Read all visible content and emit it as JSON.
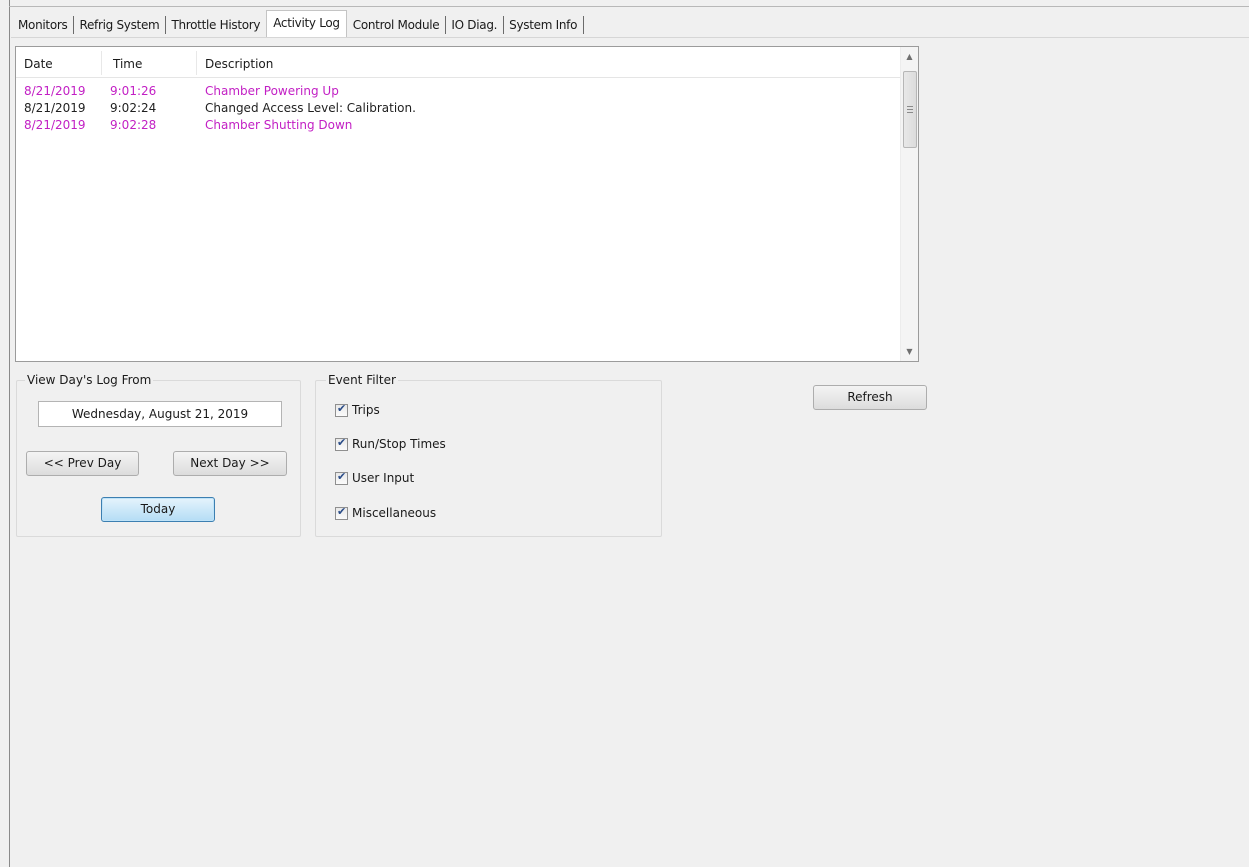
{
  "tabs": [
    "Monitors",
    "Refrig System",
    "Throttle History",
    "Activity Log",
    "Control Module",
    "IO Diag.",
    "System Info"
  ],
  "active_tab": "Activity Log",
  "log": {
    "columns": [
      "Date",
      "Time",
      "Description"
    ],
    "rows": [
      {
        "date": "8/21/2019",
        "time": "9:01:26",
        "description": "Chamber Powering Up",
        "color": "#c21fc4"
      },
      {
        "date": "8/21/2019",
        "time": "9:02:24",
        "description": "Changed Access Level: Calibration.",
        "color": "#1f1f1f"
      },
      {
        "date": "8/21/2019",
        "time": "9:02:28",
        "description": "Chamber Shutting Down",
        "color": "#c21fc4"
      }
    ]
  },
  "day_log": {
    "title": "View Day's Log From",
    "date_value": "Wednesday, August 21, 2019",
    "prev_label": "<< Prev Day",
    "next_label": "Next Day >>",
    "today_label": "Today"
  },
  "event_filter": {
    "title": "Event Filter",
    "items": [
      {
        "label": "Trips",
        "checked": true
      },
      {
        "label": "Run/Stop Times",
        "checked": true
      },
      {
        "label": "User Input",
        "checked": true
      },
      {
        "label": "Miscellaneous",
        "checked": true
      }
    ]
  },
  "refresh_label": "Refresh"
}
